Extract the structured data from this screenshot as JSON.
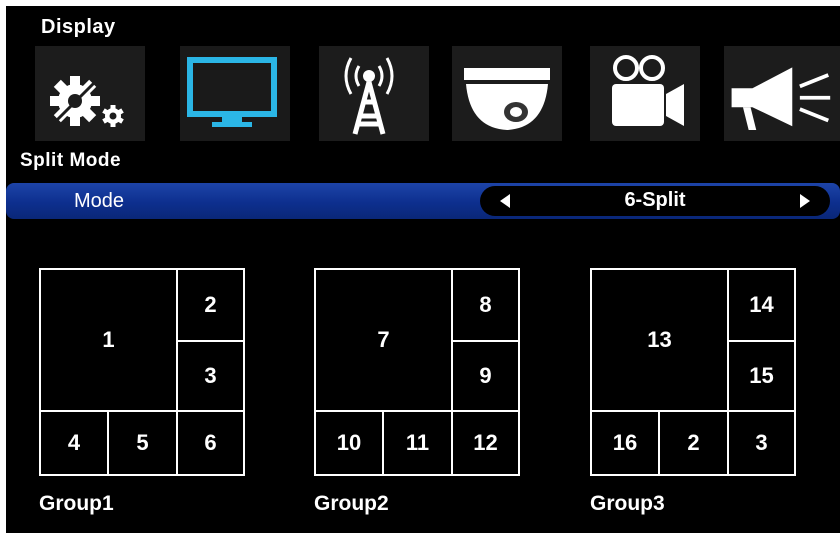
{
  "header": {
    "title": "Display"
  },
  "tabs": [
    {
      "icon": "gear-icon"
    },
    {
      "icon": "monitor-icon",
      "active": true
    },
    {
      "icon": "antenna-tower-icon"
    },
    {
      "icon": "dome-camera-icon"
    },
    {
      "icon": "video-camera-icon"
    },
    {
      "icon": "megaphone-icon"
    }
  ],
  "section": {
    "title": "Split Mode"
  },
  "mode": {
    "label": "Mode",
    "value": "6-Split"
  },
  "groups": [
    {
      "label": "Group1",
      "cells": [
        "1",
        "2",
        "3",
        "4",
        "5",
        "6"
      ]
    },
    {
      "label": "Group2",
      "cells": [
        "7",
        "8",
        "9",
        "10",
        "11",
        "12"
      ]
    },
    {
      "label": "Group3",
      "cells": [
        "13",
        "14",
        "15",
        "16",
        "2",
        "3"
      ]
    }
  ],
  "colors": {
    "highlight": "#0d2f8e",
    "active_icon": "#2bb6e6",
    "background": "#000000"
  }
}
